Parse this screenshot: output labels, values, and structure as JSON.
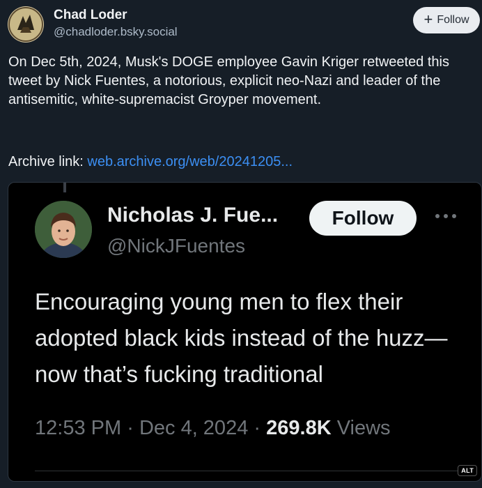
{
  "author": {
    "name": "Chad Loder",
    "handle": "@chadloder.bsky.social"
  },
  "follow_button": {
    "icon": "plus-icon",
    "label": "Follow"
  },
  "post": {
    "text": "On Dec 5th, 2024, Musk's DOGE employee Gavin Kriger retweeted this tweet by Nick Fuentes, a notorious, explicit neo-Nazi and leader of the antisemitic, white-supremacist Groyper movement.",
    "archive_label": "Archive link:",
    "archive_link": "web.archive.org/web/20241205..."
  },
  "embed": {
    "name": "Nicholas J. Fue...",
    "handle": "@NickJFuentes",
    "follow_label": "Follow",
    "more_icon": "more-horizontal-icon",
    "text": "Encouraging young men to flex their adopted black kids instead of the huzz— now that’s fucking traditional",
    "time": "12:53 PM",
    "sep1": "·",
    "date": "Dec 4, 2024",
    "sep2": "·",
    "views_count": "269.8K",
    "views_label": "Views",
    "alt_badge": "ALT"
  },
  "colors": {
    "background": "#161e27",
    "link": "#3c8ff3",
    "embed_background": "#000000"
  }
}
